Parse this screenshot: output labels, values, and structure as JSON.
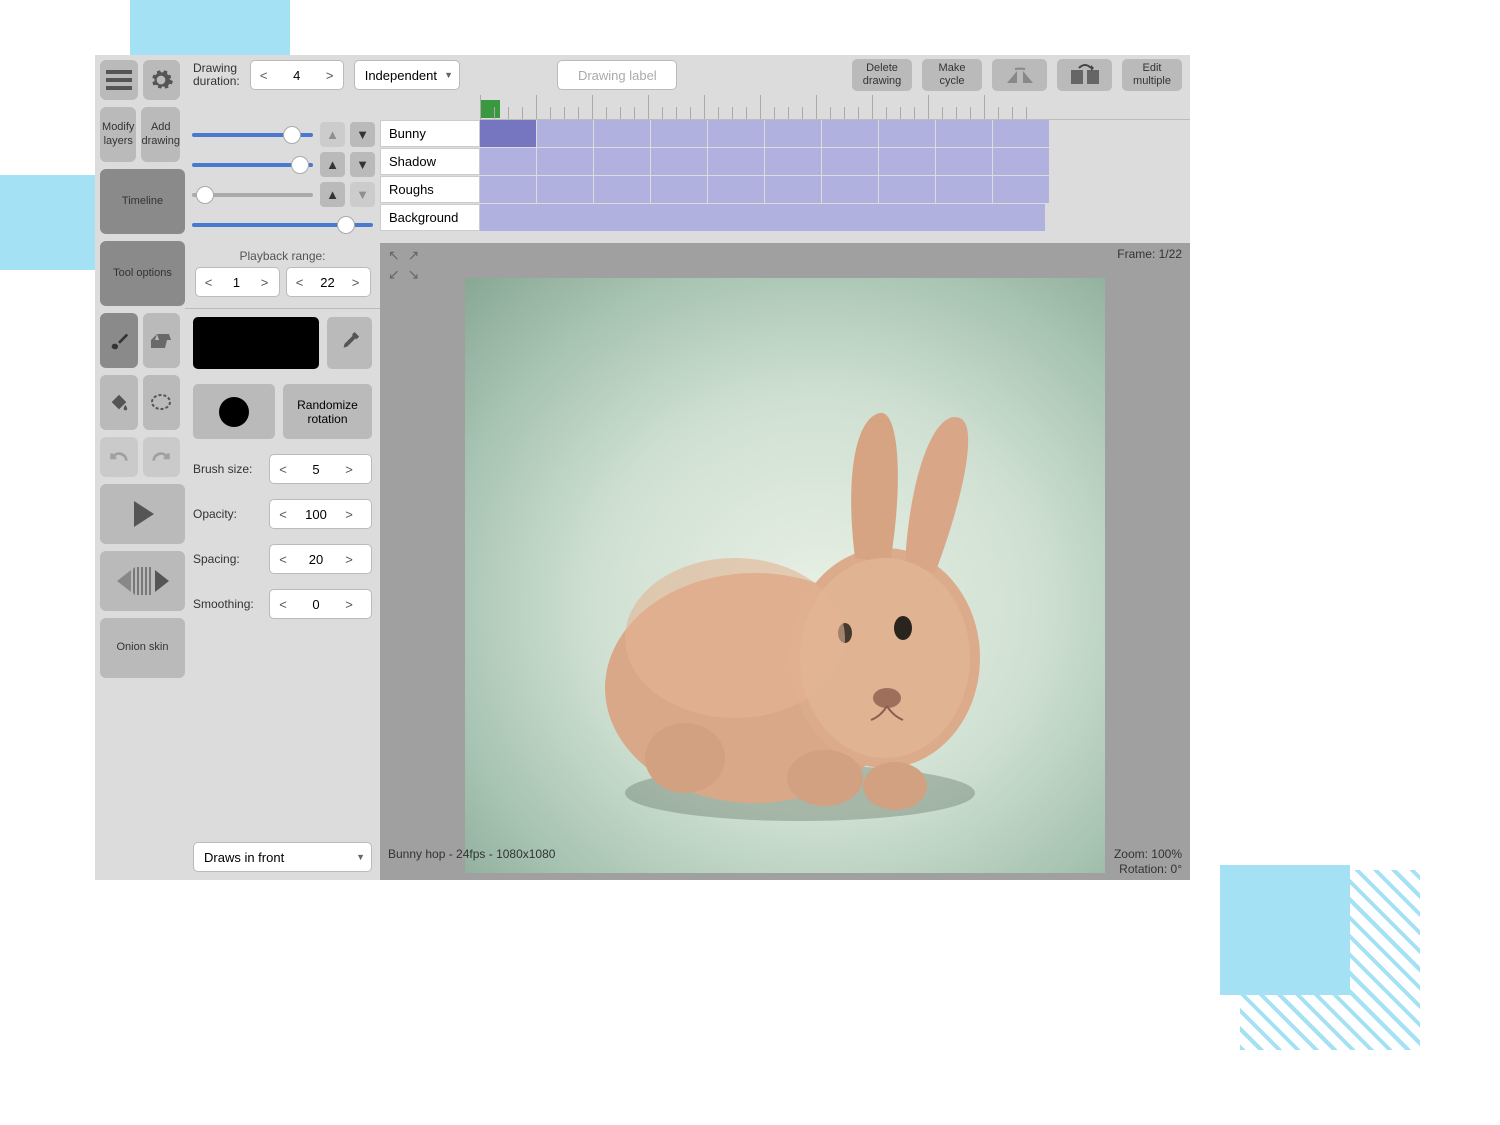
{
  "toolbar": {
    "duration_label": "Drawing\nduration:",
    "duration_value": "4",
    "mode_label": "Independent",
    "drawing_label_placeholder": "Drawing label",
    "delete_label": "Delete\ndrawing",
    "cycle_label": "Make\ncycle",
    "edit_label": "Edit\nmultiple"
  },
  "left": {
    "modify_layers": "Modify\nlayers",
    "add_drawing": "Add\ndrawing",
    "timeline": "Timeline",
    "tool_options": "Tool options",
    "onion_skin": "Onion skin"
  },
  "layers": [
    {
      "name": "Bunny",
      "opacity": 85
    },
    {
      "name": "Shadow",
      "opacity": 90
    },
    {
      "name": "Roughs",
      "opacity": 8
    },
    {
      "name": "Background",
      "opacity": 88
    }
  ],
  "playback": {
    "label": "Playback range:",
    "start": "1",
    "end": "22"
  },
  "tool": {
    "randomize": "Randomize\nrotation",
    "brush_size_label": "Brush size:",
    "brush_size": "5",
    "opacity_label": "Opacity:",
    "opacity": "100",
    "spacing_label": "Spacing:",
    "spacing": "20",
    "smoothing_label": "Smoothing:",
    "smoothing": "0",
    "draw_mode": "Draws in front",
    "current_color": "#000000"
  },
  "canvas": {
    "frame_label": "Frame: 1/22",
    "project_info": "Bunny hop - 24fps - 1080x1080",
    "zoom": "Zoom: 100%",
    "rotation": "Rotation: 0°"
  },
  "timeline": {
    "cells_per_row": 10,
    "active_cell_row": 0,
    "active_cell_index": 0
  }
}
